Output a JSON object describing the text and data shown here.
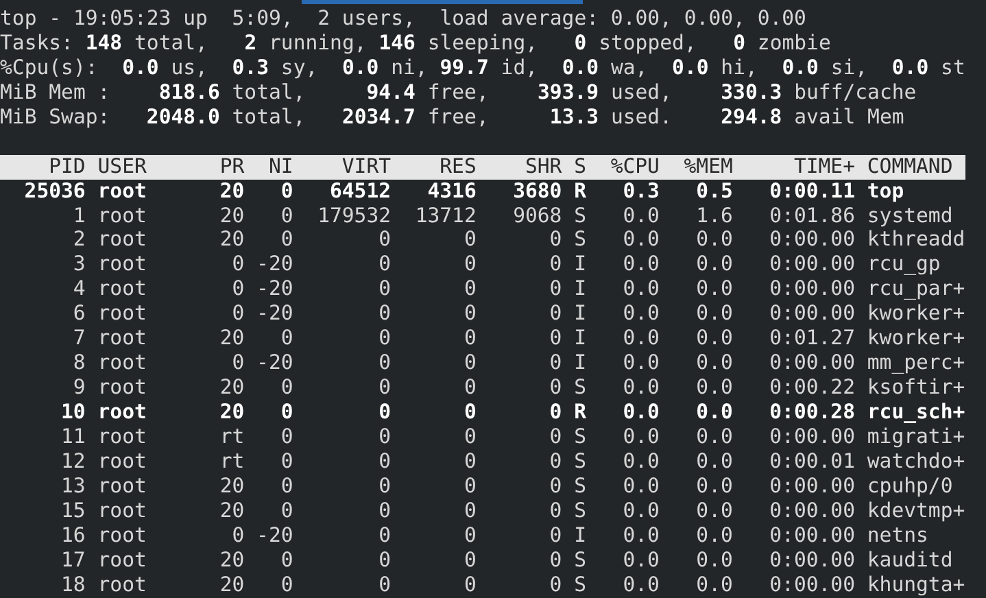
{
  "summary": [
    "top - 19:05:23 up  5:09,  2 users,  load average: 0.00, 0.00, 0.00",
    "Tasks: **148** total,   **2** running, **146** sleeping,   **0** stopped,   **0** zombie",
    "%Cpu(s):  **0.0** us,  **0.3** sy,  **0.0** ni, **99.7** id,  **0.0** wa,  **0.0** hi,  **0.0** si,  **0.0** st",
    "MiB Mem :    **818.6** total,     **94.4** free,    **393.9** used,    **330.3** buff/cache",
    "MiB Swap:   **2048.0** total,   **2034.7** free,     **13.3** used.    **294.8** avail Mem"
  ],
  "table": {
    "columns": [
      "PID",
      "USER",
      "PR",
      "NI",
      "VIRT",
      "RES",
      "SHR",
      "S",
      "%CPU",
      "%MEM",
      "TIME+",
      "COMMAND"
    ],
    "rows": [
      {
        "bold": true,
        "cells": [
          "25036",
          "root",
          "20",
          "0",
          "64512",
          "4316",
          "3680",
          "R",
          "0.3",
          "0.5",
          "0:00.11",
          "top"
        ]
      },
      {
        "bold": false,
        "cells": [
          "1",
          "root",
          "20",
          "0",
          "179532",
          "13712",
          "9068",
          "S",
          "0.0",
          "1.6",
          "0:01.86",
          "systemd"
        ]
      },
      {
        "bold": false,
        "cells": [
          "2",
          "root",
          "20",
          "0",
          "0",
          "0",
          "0",
          "S",
          "0.0",
          "0.0",
          "0:00.00",
          "kthreadd"
        ]
      },
      {
        "bold": false,
        "cells": [
          "3",
          "root",
          "0",
          "-20",
          "0",
          "0",
          "0",
          "I",
          "0.0",
          "0.0",
          "0:00.00",
          "rcu_gp"
        ]
      },
      {
        "bold": false,
        "cells": [
          "4",
          "root",
          "0",
          "-20",
          "0",
          "0",
          "0",
          "I",
          "0.0",
          "0.0",
          "0:00.00",
          "rcu_par+"
        ]
      },
      {
        "bold": false,
        "cells": [
          "6",
          "root",
          "0",
          "-20",
          "0",
          "0",
          "0",
          "I",
          "0.0",
          "0.0",
          "0:00.00",
          "kworker+"
        ]
      },
      {
        "bold": false,
        "cells": [
          "7",
          "root",
          "20",
          "0",
          "0",
          "0",
          "0",
          "I",
          "0.0",
          "0.0",
          "0:01.27",
          "kworker+"
        ]
      },
      {
        "bold": false,
        "cells": [
          "8",
          "root",
          "0",
          "-20",
          "0",
          "0",
          "0",
          "I",
          "0.0",
          "0.0",
          "0:00.00",
          "mm_perc+"
        ]
      },
      {
        "bold": false,
        "cells": [
          "9",
          "root",
          "20",
          "0",
          "0",
          "0",
          "0",
          "S",
          "0.0",
          "0.0",
          "0:00.22",
          "ksoftir+"
        ]
      },
      {
        "bold": true,
        "cells": [
          "10",
          "root",
          "20",
          "0",
          "0",
          "0",
          "0",
          "R",
          "0.0",
          "0.0",
          "0:00.28",
          "rcu_sch+"
        ]
      },
      {
        "bold": false,
        "cells": [
          "11",
          "root",
          "rt",
          "0",
          "0",
          "0",
          "0",
          "S",
          "0.0",
          "0.0",
          "0:00.00",
          "migrati+"
        ]
      },
      {
        "bold": false,
        "cells": [
          "12",
          "root",
          "rt",
          "0",
          "0",
          "0",
          "0",
          "S",
          "0.0",
          "0.0",
          "0:00.01",
          "watchdo+"
        ]
      },
      {
        "bold": false,
        "cells": [
          "13",
          "root",
          "20",
          "0",
          "0",
          "0",
          "0",
          "S",
          "0.0",
          "0.0",
          "0:00.00",
          "cpuhp/0"
        ]
      },
      {
        "bold": false,
        "cells": [
          "15",
          "root",
          "20",
          "0",
          "0",
          "0",
          "0",
          "S",
          "0.0",
          "0.0",
          "0:00.00",
          "kdevtmp+"
        ]
      },
      {
        "bold": false,
        "cells": [
          "16",
          "root",
          "0",
          "-20",
          "0",
          "0",
          "0",
          "I",
          "0.0",
          "0.0",
          "0:00.00",
          "netns"
        ]
      },
      {
        "bold": false,
        "cells": [
          "17",
          "root",
          "20",
          "0",
          "0",
          "0",
          "0",
          "S",
          "0.0",
          "0.0",
          "0:00.00",
          "kauditd"
        ]
      },
      {
        "bold": false,
        "cells": [
          "18",
          "root",
          "20",
          "0",
          "0",
          "0",
          "0",
          "S",
          "0.0",
          "0.0",
          "0:00.00",
          "khungta+"
        ]
      }
    ]
  }
}
